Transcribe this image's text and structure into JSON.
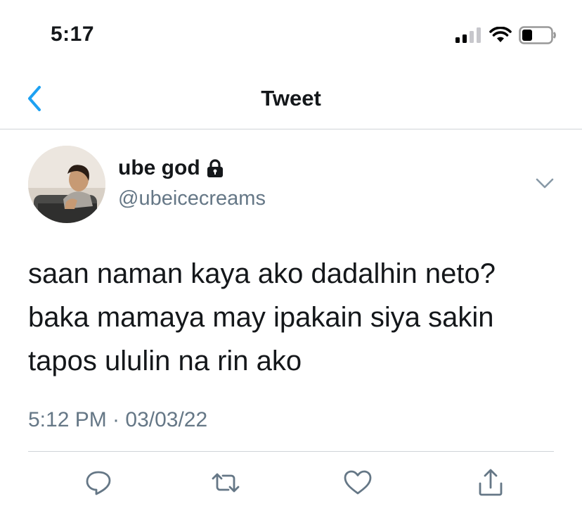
{
  "status_bar": {
    "time": "5:17",
    "icons": [
      "signal-icon",
      "wifi-icon",
      "battery-icon"
    ]
  },
  "nav": {
    "back_icon": "chevron-left-icon",
    "title": "Tweet"
  },
  "tweet": {
    "author": {
      "display_name": "ube god",
      "protected_icon": "lock-icon",
      "username": "@ubeicecreams"
    },
    "more_icon": "chevron-down-icon",
    "text_lines": [
      "saan naman kaya ako dadalhin neto?",
      "baka mamaya may ipakain siya sakin",
      "tapos ululin na rin ako"
    ],
    "timestamp": "5:12 PM · 03/03/22"
  },
  "actions": [
    "reply-icon",
    "retweet-icon",
    "like-icon",
    "share-icon"
  ],
  "colors": {
    "accent": "#1da1f2",
    "text": "#14171a",
    "secondary": "#657786",
    "divider": "#d0d4d8"
  }
}
